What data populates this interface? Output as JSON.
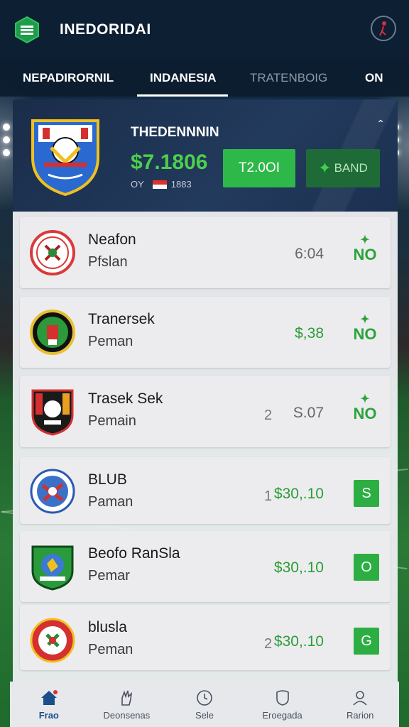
{
  "header": {
    "title": "INEDORIDAI"
  },
  "tabs": [
    {
      "label": "NEPADIRORNIL",
      "state": "normal"
    },
    {
      "label": "INDANESIA",
      "state": "active"
    },
    {
      "label": "TRATENBOIG",
      "state": "muted"
    },
    {
      "label": "ON",
      "state": "normal"
    }
  ],
  "featured": {
    "title": "THEDENNNIN",
    "price": "$7.1806",
    "sub_prefix": "OY",
    "sub_value": "1883",
    "primary_button": "T2.0OI",
    "secondary_button": "BAND"
  },
  "rows": [
    {
      "name": "Neafon",
      "sub": "Pfslan",
      "num": "",
      "price": "6:04",
      "price_style": "gray",
      "badge_type": "no",
      "badge": "NO"
    },
    {
      "name": "Tranersek",
      "sub": "Peman",
      "num": "",
      "price": "$,38",
      "price_style": "green",
      "badge_type": "no",
      "badge": "NO"
    },
    {
      "name": "Trasek Sek",
      "sub": "Pemain",
      "num": "2",
      "price": "S.07",
      "price_style": "gray",
      "badge_type": "no",
      "badge": "NO"
    },
    {
      "name": "BLUB",
      "sub": "Paman",
      "num": "1",
      "price": "$30,.10",
      "price_style": "green",
      "badge_type": "box",
      "badge": "S"
    },
    {
      "name": "Beofo RanSla",
      "sub": "Pemar",
      "num": "",
      "price": "$30,.10",
      "price_style": "green",
      "badge_type": "box",
      "badge": "O"
    },
    {
      "name": "blusla",
      "sub": "Peman",
      "num": "2",
      "price": "$30,.10",
      "price_style": "green",
      "badge_type": "box",
      "badge": "G"
    }
  ],
  "bottom_nav": [
    {
      "label": "Frao",
      "icon": "home-icon",
      "active": true
    },
    {
      "label": "Deonsenas",
      "icon": "hand-icon",
      "active": false
    },
    {
      "label": "Sele",
      "icon": "clock-icon",
      "active": false
    },
    {
      "label": "Eroegada",
      "icon": "shield-icon",
      "active": false
    },
    {
      "label": "Rarion",
      "icon": "user-icon",
      "active": false
    }
  ],
  "colors": {
    "accent_green": "#2fb84a",
    "header_bg": "#0d1f33",
    "card_bg": "#223a5c"
  }
}
